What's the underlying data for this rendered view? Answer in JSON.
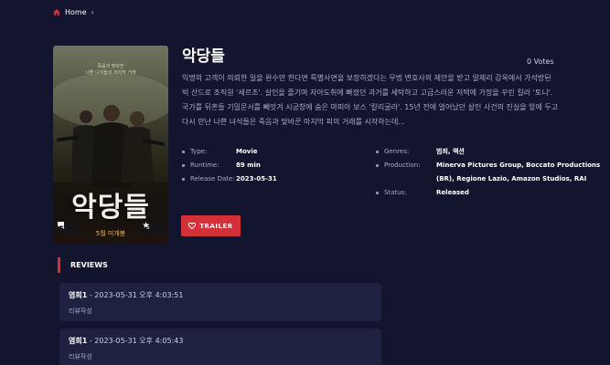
{
  "breadcrumb": {
    "home_label": "Home",
    "icon": "home-icon"
  },
  "movie": {
    "title": "악당들",
    "votes": "0 Votes",
    "overview": "익명의 고객이 의뢰한 일을 완수만 한다면 특별사면을 보장하겠다는 무법 변호사의 제안을 받고 알제리 감옥에서 가석방된 빅 산드로 조직원 '세르조'. 살인을 즐기며 자아도취에 빠졌던 과거를 세탁하고 고급스러운 저택에 가정을 꾸린 킬러 '토니'. 국가를 뒤흔들 기밀문서를 빼앗겨 시궁창에 숨은 마피아 보스 '칼리굴라'. 15년 전에 얼어났던 살인 사건의 진실을 앞에 두고 다시 만난 나쁜 녀석들은 죽음과 맞바꾼 마지막 피의 거래를 시작하는데...",
    "poster": {
      "tagline_line1": "죽음과 맞바꾼",
      "tagline_line2": "나쁜 녀석들의 마지막 거래",
      "title": "악당들",
      "date_text": "5월 미개봉",
      "comments_count": "4",
      "likes_count": "5"
    }
  },
  "info_left": [
    {
      "label": "Type:",
      "value": "Movie"
    },
    {
      "label": "Runtime:",
      "value": "89 min"
    },
    {
      "label": "Release Date:",
      "value": "2023-05-31"
    }
  ],
  "info_right": [
    {
      "label": "Genres:",
      "value": "범죄, 액션"
    },
    {
      "label": "Production:",
      "value": "Minerva Pictures Group, Boccato Productions (BR), Regione Lazio, Amazon Studios, RAI"
    },
    {
      "label": "Status:",
      "value": "Released"
    }
  ],
  "trailer_button": {
    "label": "TRAILER"
  },
  "reviews": {
    "heading": "REVIEWS",
    "items": [
      {
        "author": "염희1",
        "date": " - 2023-05-31 오후 4:03:51",
        "body": "리뷰작성"
      },
      {
        "author": "염희1",
        "date": " - 2023-05-31 오후 4:05:43",
        "body": "리뷰작성"
      }
    ]
  },
  "colors": {
    "background": "#13152e",
    "accent": "#d23138",
    "card": "#1e2140"
  }
}
